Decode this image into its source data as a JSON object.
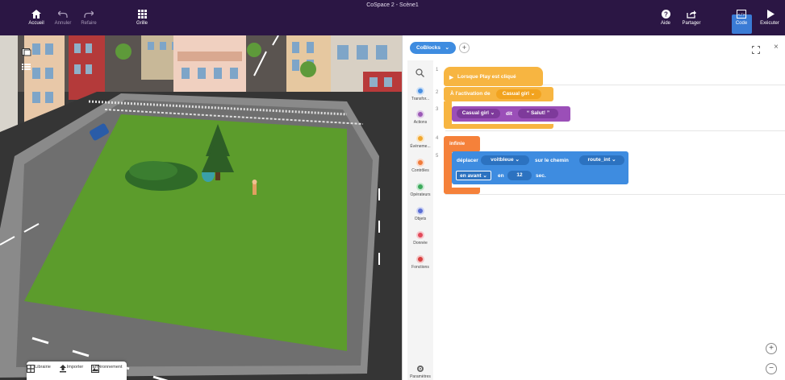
{
  "window_title": "CoSpace 2 - Scène1",
  "toolbar": {
    "home_label": "Accueil",
    "undo_label": "Annuler",
    "redo_label": "Refaire",
    "grid_label": "Grille",
    "help_label": "Aide",
    "share_label": "Partager",
    "code_label": "Code",
    "run_label": "Exécuter"
  },
  "bottom_toolbar": {
    "library_label": "Librairie",
    "import_label": "Importer",
    "environment_label": "Environnement"
  },
  "code_panel": {
    "tab_label": "CoBlocks",
    "add_tab": "+",
    "close": "×"
  },
  "categories": [
    {
      "label": "Transfor...",
      "color": "#4a90e2"
    },
    {
      "label": "Actions",
      "color": "#9b59b6"
    },
    {
      "label": "Événeme...",
      "color": "#f0a830"
    },
    {
      "label": "Contrôles",
      "color": "#f07a3a"
    },
    {
      "label": "Opérateurs",
      "color": "#3caa5c"
    },
    {
      "label": "Objets",
      "color": "#5b6fd6"
    },
    {
      "label": "Donnée",
      "color": "#e24a5a"
    },
    {
      "label": "Fonctions",
      "color": "#d94040"
    },
    {
      "label": "Paramètres",
      "color": "#666666"
    }
  ],
  "line_numbers": [
    "1",
    "2",
    "3",
    "4",
    "5"
  ],
  "blocks": {
    "when_play": "Lorsque Play est cliqué",
    "on_activation": "À l'activation de",
    "activation_target": "Casual girl",
    "say_subject": "Casual girl",
    "say_verb": "dit",
    "say_text": "Salut!",
    "forever": "infinie",
    "move_verb": "déplacer",
    "move_object": "voitbleue",
    "move_path_label": "sur le chemin",
    "move_path": "route_int",
    "move_direction": "en avant",
    "move_in": "en",
    "move_seconds": "12",
    "move_unit": "sec."
  },
  "zoom": {
    "in": "+",
    "out": "−"
  }
}
